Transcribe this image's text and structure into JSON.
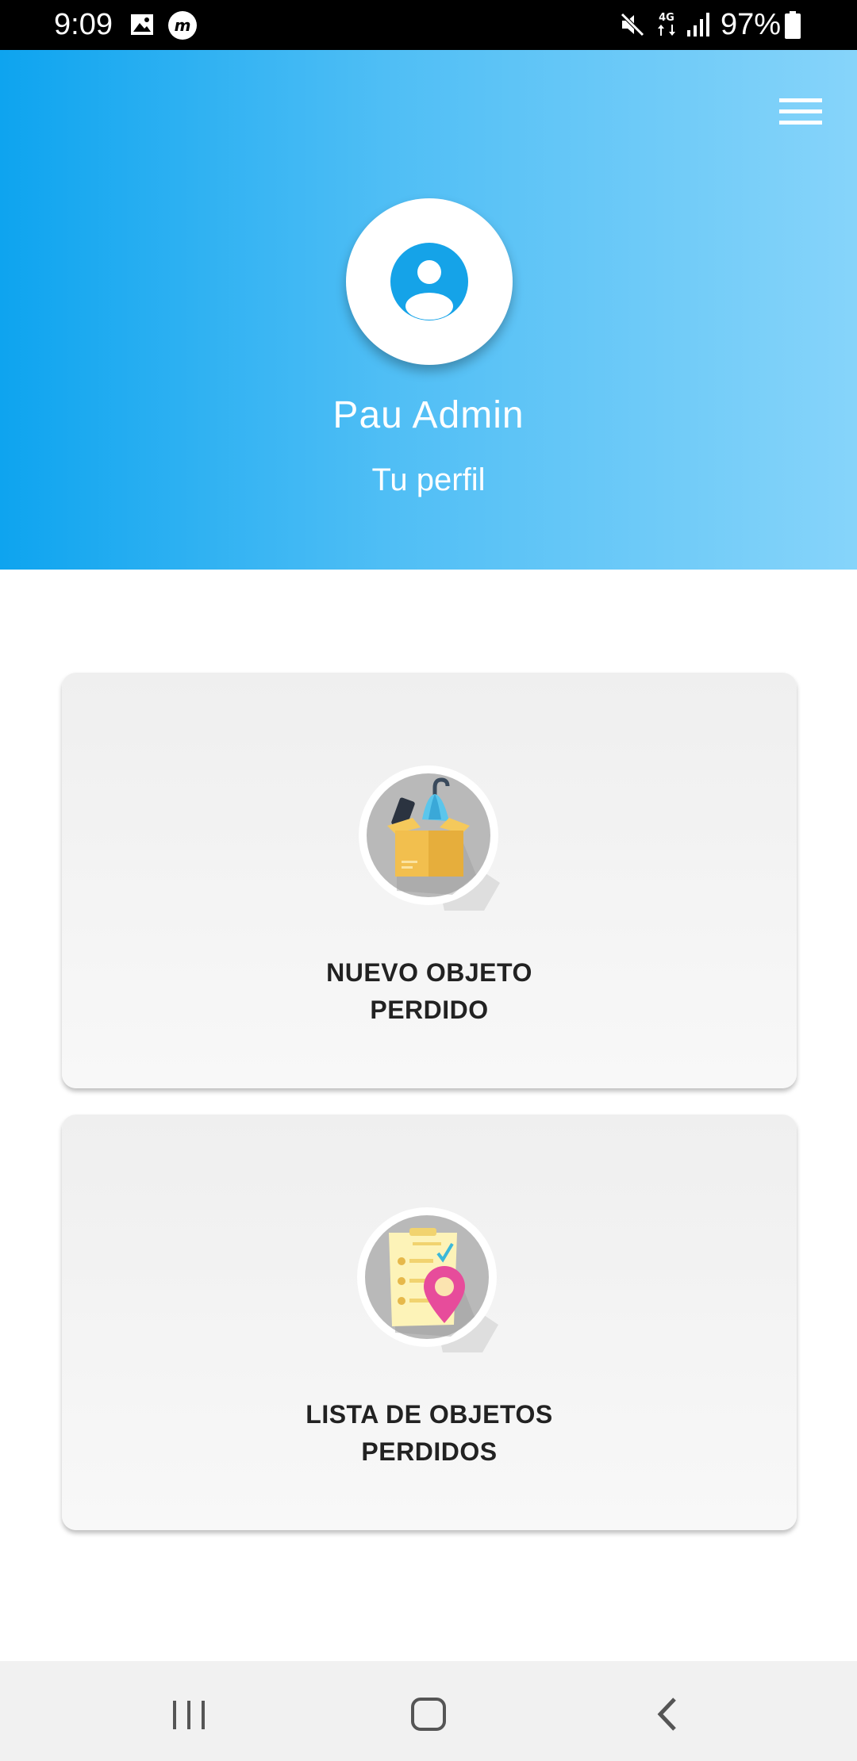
{
  "status_bar": {
    "time": "9:09",
    "battery": "97%",
    "network": "4G"
  },
  "header": {
    "user_name": "Pau Admin",
    "profile_link": "Tu perfil",
    "gradient": [
      "#0ea4ef",
      "#86d4fa"
    ]
  },
  "cards": [
    {
      "title_line1": "NUEVO OBJETO",
      "title_line2": "PERDIDO",
      "icon": "lost-box-icon"
    },
    {
      "title_line1": "LISTA DE OBJETOS",
      "title_line2": "PERDIDOS",
      "icon": "list-location-icon"
    }
  ],
  "colors": {
    "accent": "#15a3e8",
    "card_bg": "#f3f3f3",
    "nav_bg": "#f1f1f1"
  }
}
